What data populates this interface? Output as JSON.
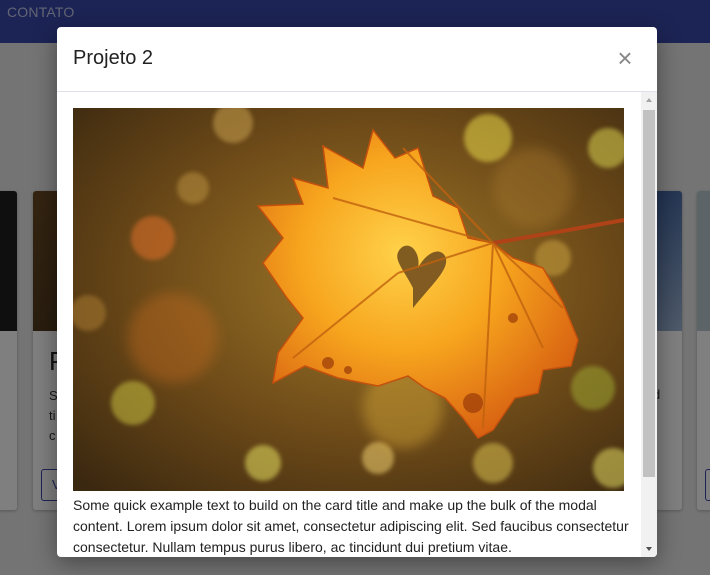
{
  "navbar": {
    "item_label": "CONTATO"
  },
  "background_cards": [
    {
      "title": "P",
      "text": "S\nti\nc",
      "button": "V"
    },
    {
      "text": "d"
    }
  ],
  "modal": {
    "title": "Projeto 2",
    "close_glyph": "×",
    "image_icon": "autumn-maple-leaf-photo",
    "body_text": "Some quick example text to build on the card title and make up the bulk of the modal content. Lorem ipsum dolor sit amet, consectetur adipiscing elit. Sed faucibus consectetur consectetur. Nullam tempus purus libero, ac tincidunt dui pretium vitae."
  },
  "colors": {
    "navbar": "#3949ab",
    "overlay": "rgba(0,0,0,0.5)",
    "scroll_thumb": "#c1c1c1"
  }
}
